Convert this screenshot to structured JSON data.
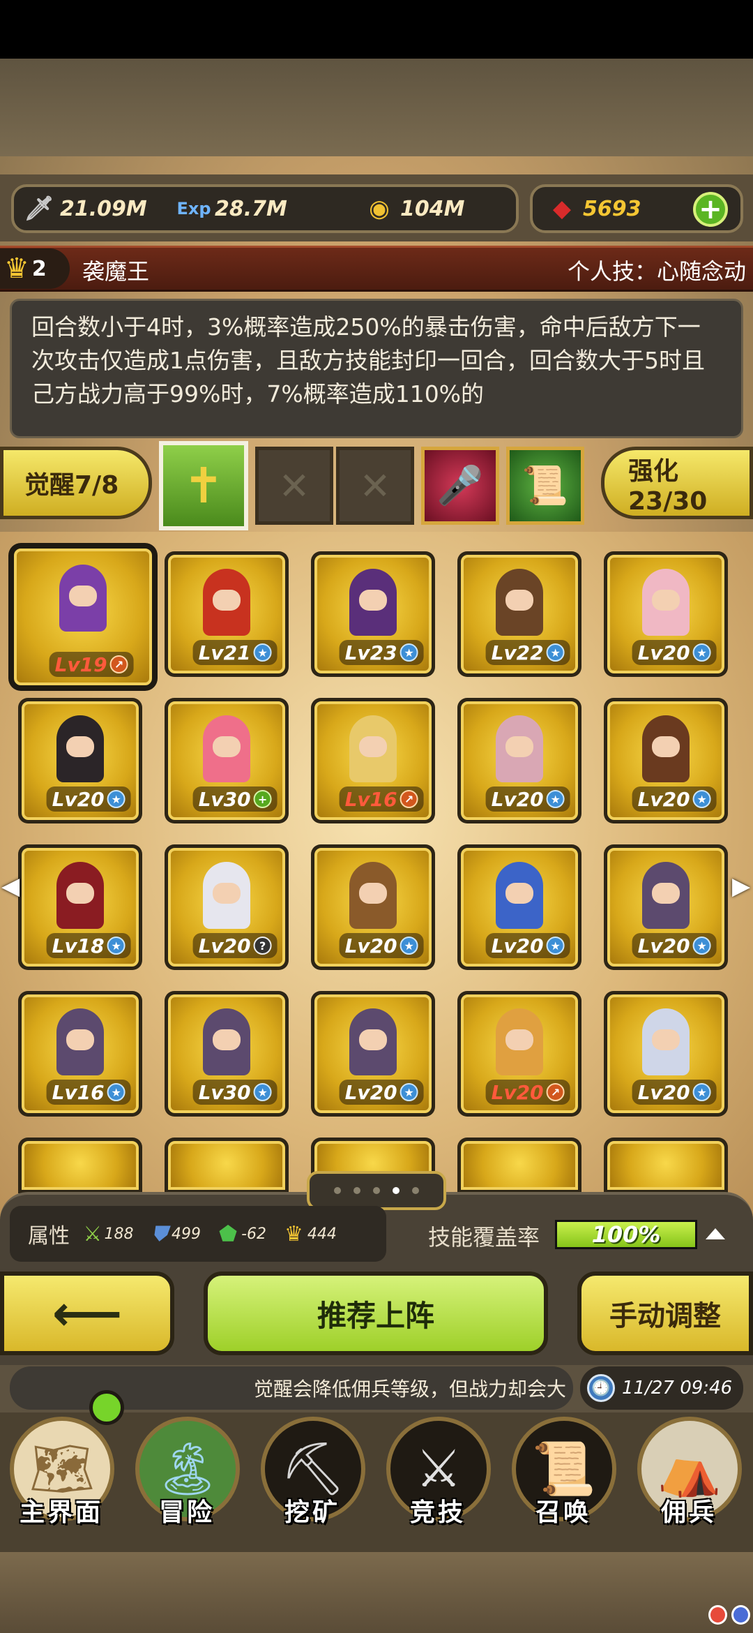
{
  "resources": {
    "attack": {
      "icon": "sword-icon",
      "value": "21.09M"
    },
    "exp": {
      "icon": "exp-icon",
      "value": "28.7M"
    },
    "gold": {
      "icon": "coin-icon",
      "value": "104M"
    },
    "gems": {
      "icon": "gem-icon",
      "value": "5693"
    }
  },
  "hero": {
    "rank": "2",
    "name": "袭魔王",
    "personal_skill": "个人技：心随念动",
    "description": "回合数小于4时，3%概率造成250%的暴击伤害，命中后敌方下一次攻击仅造成1点伤害，且敌方技能封印一回合，回合数大于5时且己方战力高于99%时，7%概率造成110%的"
  },
  "awaken": {
    "label": "觉醒7/8"
  },
  "strengthen": {
    "label": "强化23/30"
  },
  "skill_slots": [
    "cross-skill-icon",
    "empty-slot",
    "empty-slot",
    "microphone-skill-icon",
    "scroll-skill-icon"
  ],
  "heroes": [
    {
      "level": "Lv19",
      "badge": "up",
      "red": true,
      "hair": "#7b3fa8"
    },
    {
      "level": "Lv21",
      "badge": "star",
      "red": false,
      "hair": "#c8321f"
    },
    {
      "level": "Lv23",
      "badge": "star",
      "red": false,
      "hair": "#5a2f7a"
    },
    {
      "level": "Lv22",
      "badge": "star",
      "red": false,
      "hair": "#6a4426"
    },
    {
      "level": "Lv20",
      "badge": "star",
      "red": false,
      "hair": "#f0b8c4"
    },
    {
      "level": "Lv20",
      "badge": "star",
      "red": false,
      "hair": "#2b2528"
    },
    {
      "level": "Lv30",
      "badge": "plus",
      "red": false,
      "hair": "#ef6f8a"
    },
    {
      "level": "Lv16",
      "badge": "up",
      "red": true,
      "hair": "#e8c96a"
    },
    {
      "level": "Lv20",
      "badge": "star",
      "red": false,
      "hair": "#d9a7b4"
    },
    {
      "level": "Lv20",
      "badge": "star",
      "red": false,
      "hair": "#6a3a1f"
    },
    {
      "level": "Lv18",
      "badge": "star",
      "red": false,
      "hair": "#8a1c22"
    },
    {
      "level": "Lv20",
      "badge": "question",
      "red": false,
      "hair": "#e6e6ee"
    },
    {
      "level": "Lv20",
      "badge": "star",
      "red": false,
      "hair": "#8a5a2a"
    },
    {
      "level": "Lv20",
      "badge": "star",
      "red": false,
      "hair": "#3c64c8"
    },
    {
      "level": "Lv20",
      "badge": "star",
      "red": false,
      "hair": "#5c4a6e"
    },
    {
      "level": "Lv16",
      "badge": "star",
      "red": false,
      "hair": "#5c4a6e"
    },
    {
      "level": "Lv30",
      "badge": "star",
      "red": false,
      "hair": "#5c4a6e"
    },
    {
      "level": "Lv20",
      "badge": "star",
      "red": false,
      "hair": "#5c4a6e"
    },
    {
      "level": "Lv20",
      "badge": "up",
      "red": true,
      "hair": "#e0a040"
    },
    {
      "level": "Lv20",
      "badge": "star",
      "red": false,
      "hair": "#cfd6e8"
    }
  ],
  "attributes": {
    "label": "属性",
    "items": [
      {
        "icon": "sword-green-icon",
        "value": "188"
      },
      {
        "icon": "shield-icon",
        "value": "499"
      },
      {
        "icon": "boot-icon",
        "value": "-62"
      },
      {
        "icon": "crown-icon",
        "value": "444"
      }
    ]
  },
  "coverage": {
    "label": "技能覆盖率",
    "value": "100%",
    "fraction": 1.0
  },
  "buttons": {
    "recommend": "推荐上阵",
    "manual": "手动调整"
  },
  "ticker": {
    "text": "觉醒会降低佣兵等级，但战力却会大",
    "time": "11/27 09:46"
  },
  "nav": [
    {
      "label": "主界面",
      "icon": "map-scroll-icon"
    },
    {
      "label": "冒险",
      "icon": "island-icon"
    },
    {
      "label": "挖矿",
      "icon": "pickaxe-icon"
    },
    {
      "label": "竞技",
      "icon": "crossed-swords-icon"
    },
    {
      "label": "召唤",
      "icon": "summon-scroll-icon"
    },
    {
      "label": "佣兵",
      "icon": "tent-icon"
    }
  ]
}
